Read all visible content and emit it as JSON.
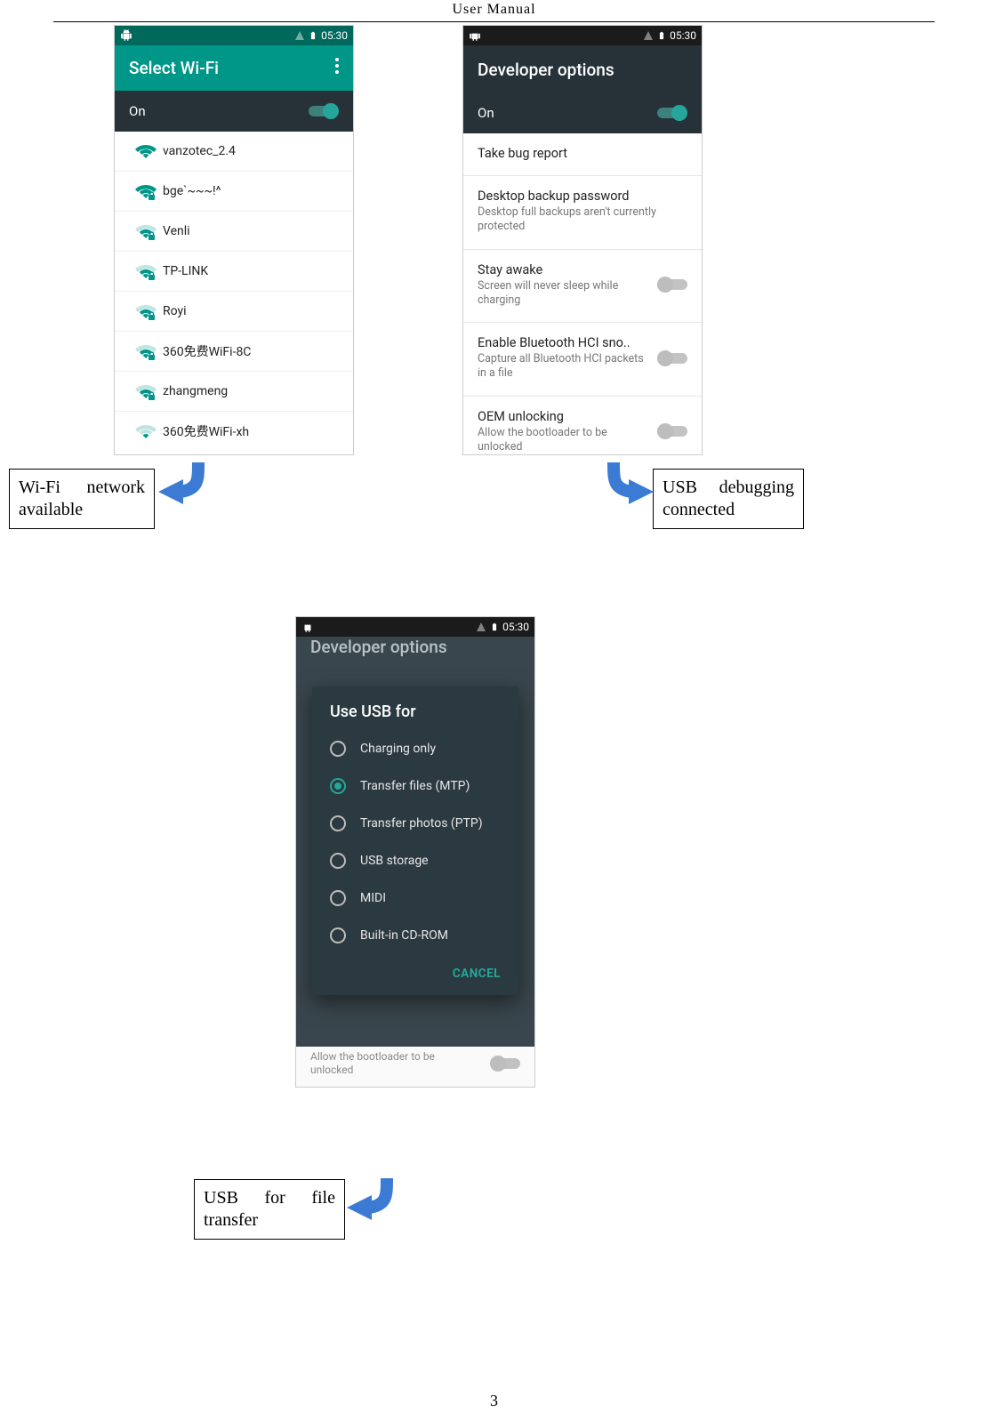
{
  "doc": {
    "header": "User  Manual",
    "page_number": "3"
  },
  "status": {
    "time": "05:30"
  },
  "wifi": {
    "title": "Select Wi-Fi",
    "on_label": "On",
    "networks": [
      {
        "name": "vanzotec_2.4",
        "strength": "full",
        "locked": false
      },
      {
        "name": "bge`~~~!^",
        "strength": "full",
        "locked": true
      },
      {
        "name": "Venli",
        "strength": "med",
        "locked": true
      },
      {
        "name": "TP-LINK",
        "strength": "med",
        "locked": true
      },
      {
        "name": "Royi",
        "strength": "med",
        "locked": true
      },
      {
        "name": "360免费WiFi-8C",
        "strength": "med",
        "locked": true
      },
      {
        "name": "zhangmeng",
        "strength": "med",
        "locked": true
      },
      {
        "name": "360免费WiFi-xh",
        "strength": "low",
        "locked": false
      }
    ]
  },
  "dev": {
    "title": "Developer options",
    "on_label": "On",
    "items": [
      {
        "title": "Take bug report",
        "sub": "",
        "toggle": false
      },
      {
        "title": "Desktop backup password",
        "sub": "Desktop full backups aren't currently protected",
        "toggle": false
      },
      {
        "title": "Stay awake",
        "sub": "Screen will never sleep while charging",
        "toggle": true
      },
      {
        "title": "Enable Bluetooth HCI sno..",
        "sub": "Capture all Bluetooth HCI packets in a file",
        "toggle": true
      },
      {
        "title": "OEM unlocking",
        "sub": "Allow the bootloader to be unlocked",
        "toggle": true
      }
    ]
  },
  "usb": {
    "header": "Developer options",
    "dialog_title": "Use USB for",
    "options": [
      {
        "label": "Charging only",
        "selected": false
      },
      {
        "label": "Transfer files (MTP)",
        "selected": true
      },
      {
        "label": "Transfer photos (PTP)",
        "selected": false
      },
      {
        "label": "USB storage",
        "selected": false
      },
      {
        "label": "MIDI",
        "selected": false
      },
      {
        "label": "Built-in CD-ROM",
        "selected": false
      }
    ],
    "cancel": "CANCEL",
    "strip_text": "Allow the bootloader to be unlocked"
  },
  "callouts": {
    "wifi": "Wi-Fi network available",
    "usb_debug": "USB debugging connected",
    "usb_file": "USB for file transfer"
  }
}
